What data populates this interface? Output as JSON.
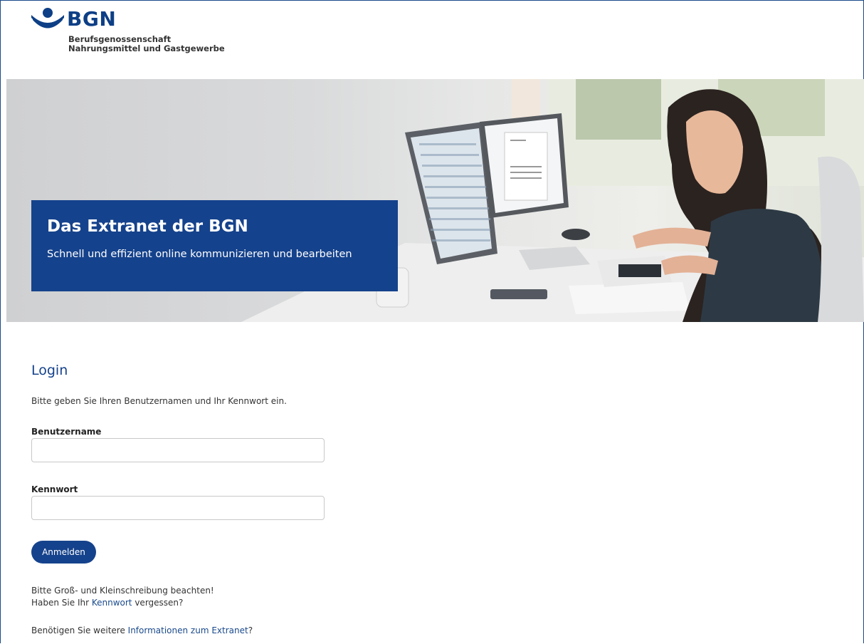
{
  "logo": {
    "wordmark": "BGN",
    "line1": "Berufsgenossenschaft",
    "line2": "Nahrungsmittel und Gastgewerbe",
    "brand_color": "#0d3f86"
  },
  "hero": {
    "title": "Das Extranet der BGN",
    "subtitle": "Schnell und effizient online kommunizieren und bearbeiten",
    "box_color": "#15428c"
  },
  "login": {
    "heading": "Login",
    "intro": "Bitte geben Sie Ihren Benutzernamen und Ihr Kennwort ein.",
    "username_label": "Benutzername",
    "username_value": "",
    "password_label": "Kennwort",
    "password_value": "",
    "submit_label": "Anmelden"
  },
  "notes": {
    "case_hint": "Bitte Groß- und Kleinschreibung beachten!",
    "forgot_prefix": "Haben Sie Ihr ",
    "forgot_link": "Kennwort",
    "forgot_suffix": " vergessen?",
    "info_prefix": "Benötigen Sie weitere ",
    "info_link": "Informationen zum Extranet",
    "info_suffix": "?"
  }
}
